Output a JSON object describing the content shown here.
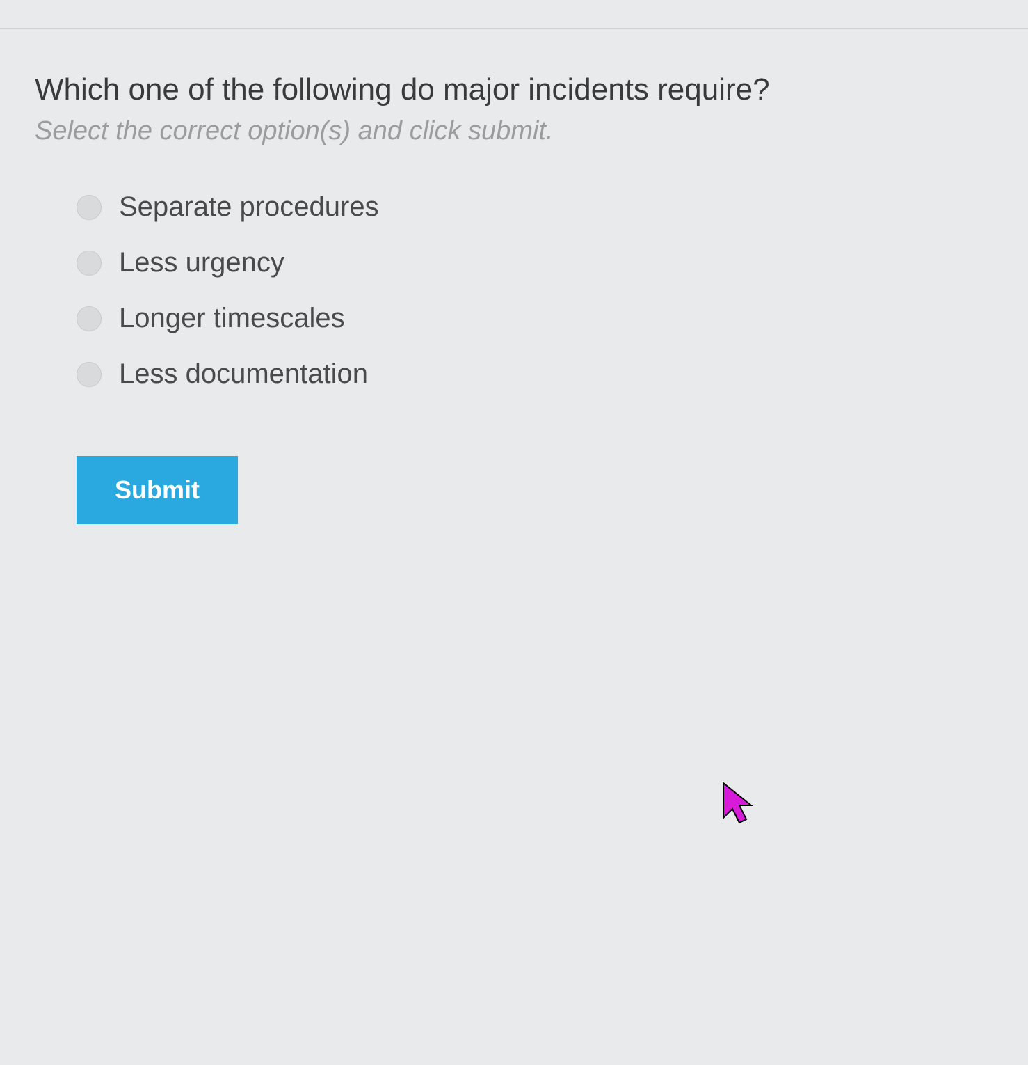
{
  "question": {
    "text": "Which one of the following do major incidents require?",
    "instruction": "Select the correct option(s) and click submit."
  },
  "options": [
    {
      "label": "Separate procedures"
    },
    {
      "label": "Less urgency"
    },
    {
      "label": "Longer timescales"
    },
    {
      "label": "Less documentation"
    }
  ],
  "submit_label": "Submit"
}
